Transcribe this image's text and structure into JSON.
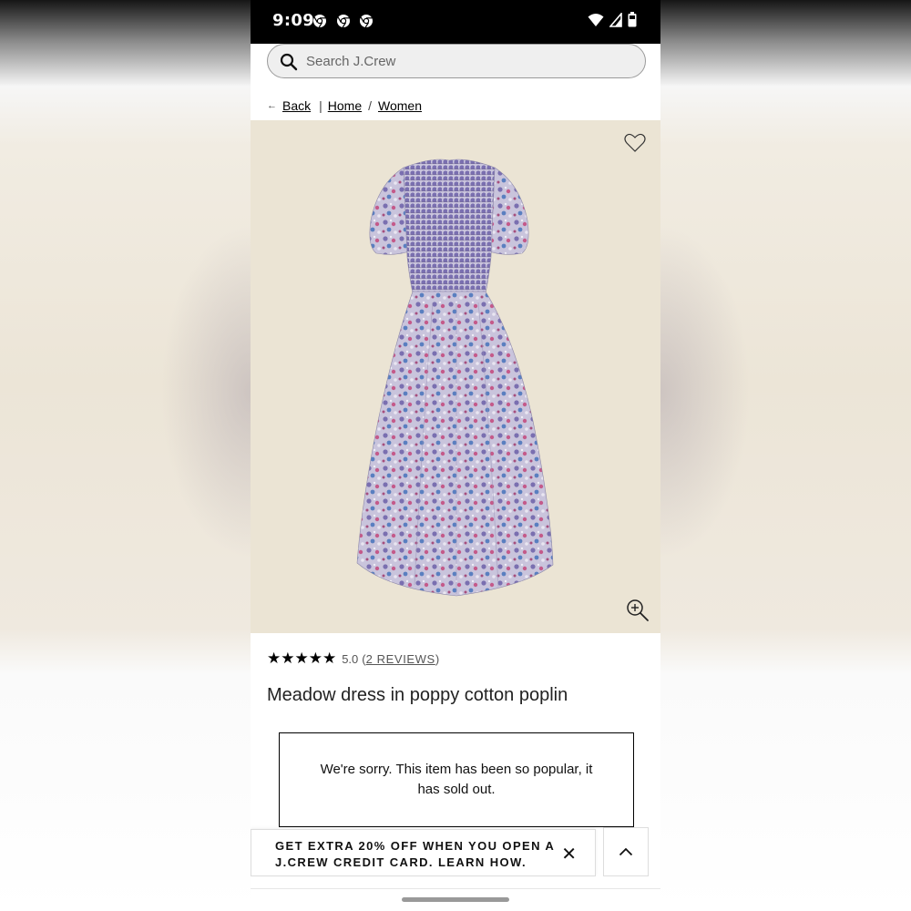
{
  "status_bar": {
    "time": "9:09",
    "notification_icons": [
      "chrome-icon",
      "chrome-icon",
      "chrome-icon"
    ],
    "system_icons": [
      "wifi-icon",
      "cell-signal-icon",
      "battery-icon"
    ]
  },
  "search": {
    "placeholder": "Search J.Crew",
    "value": ""
  },
  "breadcrumb": {
    "back_label": "Back",
    "items": [
      "Home",
      "Women"
    ],
    "separator": "/"
  },
  "product": {
    "image_subject": "dress-photo",
    "rating_stars": "★★★★★",
    "rating_value": "5.0",
    "reviews_label": "2 REVIEWS",
    "title": "Meadow dress in poppy cotton poplin",
    "soldout_message": "We're sorry. This item has been so popular, it has sold out."
  },
  "promo": {
    "text": "GET EXTRA 20% OFF WHEN YOU OPEN A J.CREW CREDIT CARD. LEARN HOW.",
    "close_label": "✕"
  },
  "colors": {
    "image_background": "#ebe4d4",
    "text": "#111111",
    "search_background": "#efefef"
  }
}
